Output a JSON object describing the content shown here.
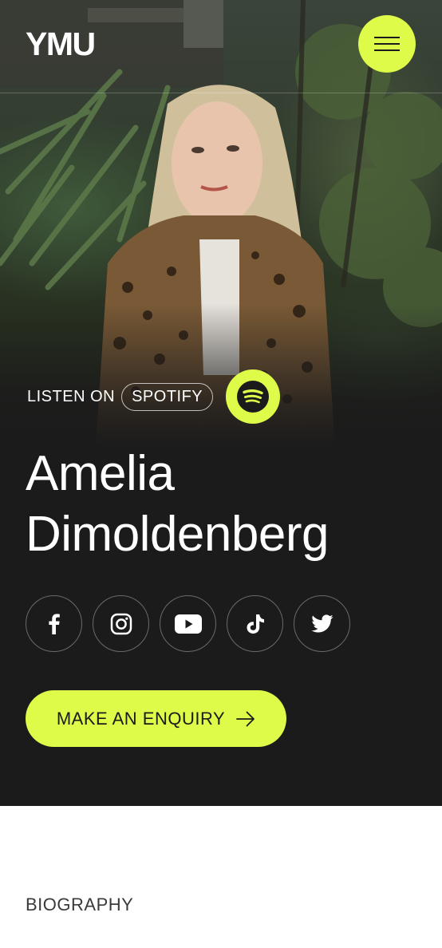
{
  "header": {
    "logo": "YMU",
    "menu_icon": "hamburger-menu-icon"
  },
  "listen": {
    "label": "LISTEN ON",
    "platform": "SPOTIFY",
    "icon": "spotify-icon"
  },
  "profile": {
    "first_name": "Amelia",
    "last_name": "Dimoldenberg"
  },
  "socials": [
    {
      "name": "facebook",
      "icon": "facebook-icon"
    },
    {
      "name": "instagram",
      "icon": "instagram-icon"
    },
    {
      "name": "youtube",
      "icon": "youtube-icon"
    },
    {
      "name": "tiktok",
      "icon": "tiktok-icon"
    },
    {
      "name": "twitter",
      "icon": "twitter-icon"
    }
  ],
  "cta": {
    "label": "MAKE AN ENQUIRY",
    "icon": "arrow-right-icon"
  },
  "section": {
    "title": "BIOGRAPHY"
  },
  "colors": {
    "accent": "#dffb4a",
    "dark": "#1b1b1b",
    "light": "#ffffff"
  }
}
